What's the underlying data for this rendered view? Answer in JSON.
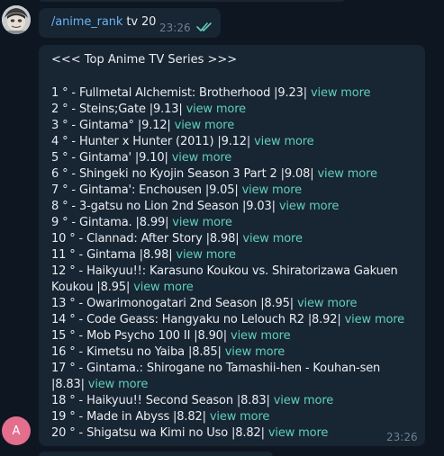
{
  "colors": {
    "background": "#0e1621",
    "bubble": "#182533",
    "text": "#e9edf0",
    "command_link": "#6ab2f2",
    "view_more_link": "#5fcfb7",
    "timestamp": "#6d7f8f",
    "bot_avatar": "#e36f8d"
  },
  "user_message": {
    "command": "/anime_rank",
    "args": " tv 20",
    "time": "23:26",
    "status_icon": "double-check-icon"
  },
  "bot_message": {
    "avatar_letter": "A",
    "title": "<<< Top Anime TV Series >>>",
    "link_label": "view more",
    "time": "23:26",
    "rows": [
      "1 ° - Fullmetal Alchemist: Brotherhood |9.23|",
      "2 ° - Steins;Gate |9.13|",
      "3 ° - Gintama° |9.12|",
      "4 ° - Hunter x Hunter (2011) |9.12|",
      "5 ° - Gintama' |9.10|",
      "6 ° - Shingeki no Kyojin Season 3 Part 2 |9.08|",
      "7 ° - Gintama': Enchousen |9.05|",
      "8 ° - 3-gatsu no Lion 2nd Season |9.03|",
      "9 ° - Gintama. |8.99|",
      "10 ° - Clannad: After Story |8.98|",
      "11 ° - Gintama |8.98|",
      "12 ° - Haikyuu!!: Karasuno Koukou vs. Shiratorizawa Gakuen Koukou |8.95|",
      "13 ° - Owarimonogatari 2nd Season |8.95|",
      "14 ° - Code Geass: Hangyaku no Lelouch R2 |8.92|",
      "15 ° - Mob Psycho 100 II |8.90|",
      "16 ° - Kimetsu no Yaiba |8.85|",
      "17 ° - Gintama.: Shirogane no Tamashii-hen - Kouhan-sen |8.83|",
      "18 ° - Haikyuu!! Second Season |8.83|",
      "19 ° - Made in Abyss |8.82|",
      "20 ° - Shigatsu wa Kimi no Uso |8.82|"
    ]
  }
}
